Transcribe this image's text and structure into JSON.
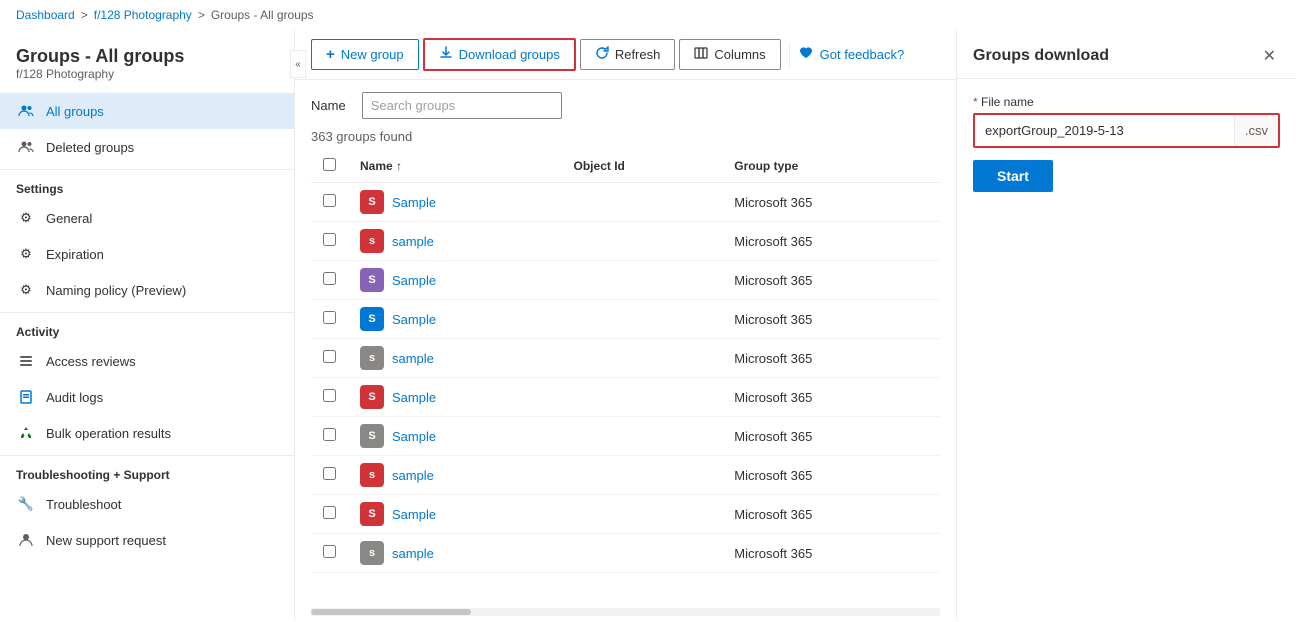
{
  "breadcrumb": {
    "items": [
      {
        "label": "Dashboard",
        "link": true
      },
      {
        "label": "f/128 Photography",
        "link": true
      },
      {
        "label": "Groups - All groups",
        "link": false
      }
    ],
    "separator": ">"
  },
  "page": {
    "title": "Groups - All groups",
    "subtitle": "f/128 Photography"
  },
  "sidebar": {
    "nav_groups": [
      {
        "label": "All groups",
        "active": true,
        "icon": "people"
      },
      {
        "label": "Deleted groups",
        "active": false,
        "icon": "people-deleted"
      }
    ],
    "settings_label": "Settings",
    "settings_items": [
      {
        "label": "General",
        "icon": "gear"
      },
      {
        "label": "Expiration",
        "icon": "gear"
      },
      {
        "label": "Naming policy (Preview)",
        "icon": "gear"
      }
    ],
    "activity_label": "Activity",
    "activity_items": [
      {
        "label": "Access reviews",
        "icon": "list"
      },
      {
        "label": "Audit logs",
        "icon": "book"
      },
      {
        "label": "Bulk operation results",
        "icon": "recycle"
      }
    ],
    "support_label": "Troubleshooting + Support",
    "support_items": [
      {
        "label": "Troubleshoot",
        "icon": "wrench"
      },
      {
        "label": "New support request",
        "icon": "person-support"
      }
    ]
  },
  "toolbar": {
    "new_group_label": "New group",
    "download_groups_label": "Download groups",
    "refresh_label": "Refresh",
    "columns_label": "Columns",
    "feedback_label": "Got feedback?"
  },
  "filter": {
    "name_label": "Name",
    "search_placeholder": "Search groups"
  },
  "table": {
    "result_count": "363 groups found",
    "columns": [
      {
        "label": "Name ↑",
        "key": "name"
      },
      {
        "label": "Object Id",
        "key": "objectId"
      },
      {
        "label": "Group type",
        "key": "groupType"
      }
    ],
    "rows": [
      {
        "name": "Sample",
        "objectId": "",
        "groupType": "Microsoft 365",
        "avatarColor": "#d13438",
        "avatarLetter": "S",
        "lowercase": false
      },
      {
        "name": "sample",
        "objectId": "",
        "groupType": "Microsoft 365",
        "avatarColor": "#d13438",
        "avatarLetter": "s",
        "lowercase": true
      },
      {
        "name": "Sample",
        "objectId": "",
        "groupType": "Microsoft 365",
        "avatarColor": "#8764b8",
        "avatarLetter": "S",
        "lowercase": false
      },
      {
        "name": "Sample",
        "objectId": "",
        "groupType": "Microsoft 365",
        "avatarColor": "#0078d4",
        "avatarLetter": "S",
        "lowercase": false
      },
      {
        "name": "sample",
        "objectId": "",
        "groupType": "Microsoft 365",
        "avatarColor": "#8a8886",
        "avatarLetter": "s",
        "lowercase": true
      },
      {
        "name": "Sample",
        "objectId": "",
        "groupType": "Microsoft 365",
        "avatarColor": "#d13438",
        "avatarLetter": "S",
        "lowercase": false
      },
      {
        "name": "Sample",
        "objectId": "",
        "groupType": "Microsoft 365",
        "avatarColor": "#8a8886",
        "avatarLetter": "S",
        "lowercase": false
      },
      {
        "name": "sample",
        "objectId": "",
        "groupType": "Microsoft 365",
        "avatarColor": "#d13438",
        "avatarLetter": "s",
        "lowercase": true
      },
      {
        "name": "Sample",
        "objectId": "",
        "groupType": "Microsoft 365",
        "avatarColor": "#d13438",
        "avatarLetter": "S",
        "lowercase": false
      },
      {
        "name": "sample",
        "objectId": "",
        "groupType": "Microsoft 365",
        "avatarColor": "#8a8886",
        "avatarLetter": "s",
        "lowercase": true
      }
    ]
  },
  "panel": {
    "title": "Groups download",
    "file_name_label": "File name",
    "file_name_required": "*",
    "file_name_value": "exportGroup_2019-5-13",
    "file_ext": ".csv",
    "start_label": "Start"
  },
  "colors": {
    "accent": "#0078d4",
    "danger": "#d13438"
  }
}
